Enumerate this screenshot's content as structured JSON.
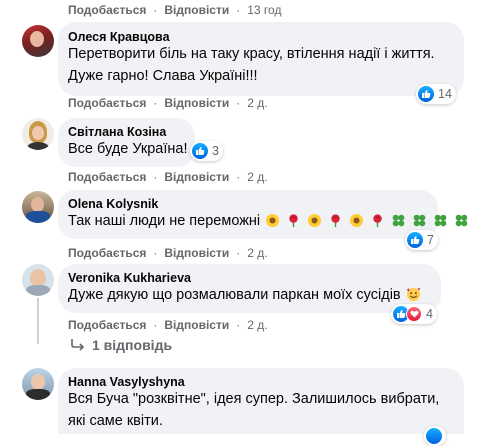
{
  "top_actions": {
    "like": "Подобається",
    "reply": "Відповісти",
    "time": "13 год"
  },
  "comments": [
    {
      "author": "Олеся Кравцова",
      "lines": [
        "Перетворити біль на таку красу, втілення надії і життя.",
        "Дуже гарно! Слава Україні!!!"
      ],
      "like": "Подобається",
      "reply": "Відповісти",
      "time": "2 д.",
      "reactions": "14"
    },
    {
      "author": "Світлана Козіна",
      "lines": [
        "Все буде Україна!"
      ],
      "like": "Подобається",
      "reply": "Відповісти",
      "time": "2 д.",
      "reactions": "3"
    },
    {
      "author": "Olena Kolysnik",
      "lines": [
        "Так наші люди не переможні"
      ],
      "like": "Подобається",
      "reply": "Відповісти",
      "time": "2 д.",
      "reactions": "7"
    },
    {
      "author": "Veronika Kukharieva",
      "lines": [
        "Дуже дякую що розмалювали паркан моїх сусідів"
      ],
      "like": "Подобається",
      "reply": "Відповісти",
      "time": "2 д.",
      "reactions": "4"
    },
    {
      "author": "Hanna Vasylyshyna",
      "lines": [
        "Вся Буча \"розквітне\", ідея супер. Залишилось вибрати,",
        "які саме квіти."
      ],
      "reactions": ""
    }
  ],
  "replies_link": "1 відповідь",
  "icons": {
    "like": "like-icon",
    "love": "love-icon",
    "reply_arrow": "reply-arrow-icon"
  },
  "colors": {
    "bubble": "#f0f2f5",
    "meta": "#65676b",
    "like_blue": "#1877f2",
    "love_red": "#f33e58"
  }
}
